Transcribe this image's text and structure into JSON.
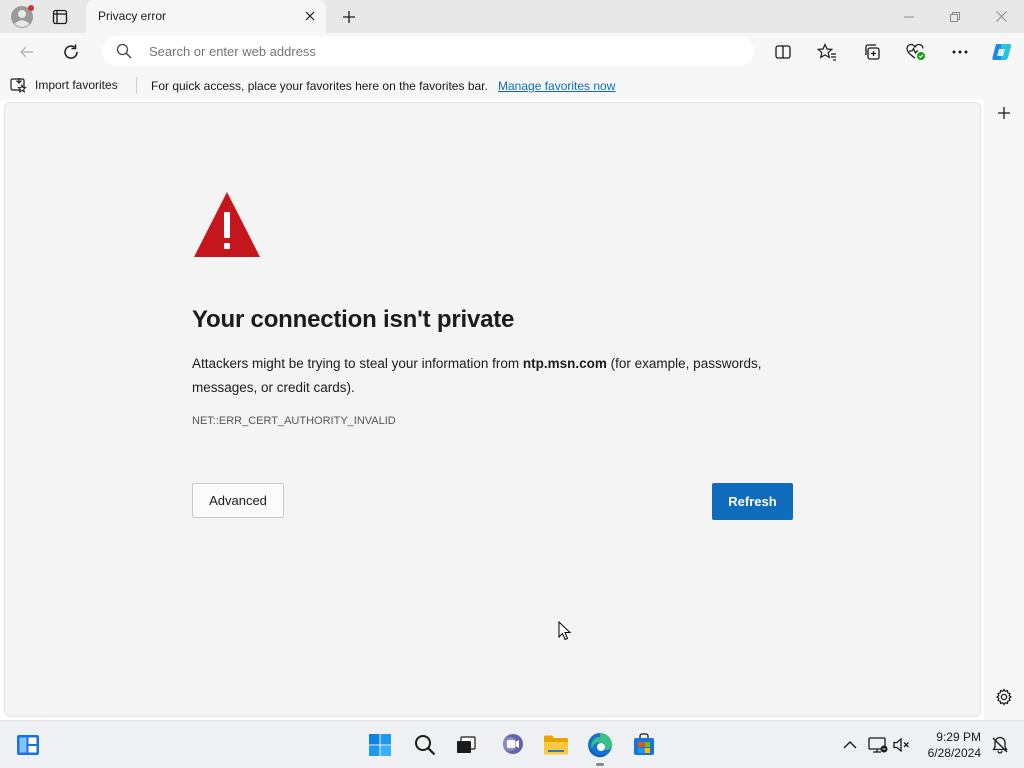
{
  "window": {
    "tab_title": "Privacy error"
  },
  "toolbar": {
    "address_placeholder": "Search or enter web address"
  },
  "favorites_bar": {
    "import_label": "Import favorites",
    "message": "For quick access, place your favorites here on the favorites bar.",
    "link": "Manage favorites now"
  },
  "error_page": {
    "title": "Your connection isn't private",
    "desc_before": "Attackers might be trying to steal your information from ",
    "domain": "ntp.msn.com",
    "desc_after": " (for example, passwords, messages, or credit cards).",
    "code": "NET::ERR_CERT_AUTHORITY_INVALID",
    "advanced_label": "Advanced",
    "refresh_label": "Refresh"
  },
  "taskbar": {
    "time": "9:29 PM",
    "date": "6/28/2024"
  },
  "colors": {
    "accent": "#0f6cbd",
    "warning": "#c4161c"
  },
  "icons": [
    "profile-icon",
    "tab-actions-icon",
    "close-icon",
    "new-tab-icon",
    "minimize-icon",
    "restore-icon",
    "back-icon",
    "refresh-icon",
    "search-icon",
    "split-screen-icon",
    "favorites-icon",
    "collections-icon",
    "browser-essentials-icon",
    "more-icon",
    "copilot-icon",
    "import-favorites-icon",
    "warning-icon",
    "add-icon",
    "settings-icon",
    "widgets-icon",
    "start-icon",
    "task-view-icon",
    "teams-icon",
    "file-explorer-icon",
    "edge-icon",
    "store-icon",
    "chevron-up-icon",
    "network-icon",
    "volume-icon",
    "notification-icon"
  ]
}
